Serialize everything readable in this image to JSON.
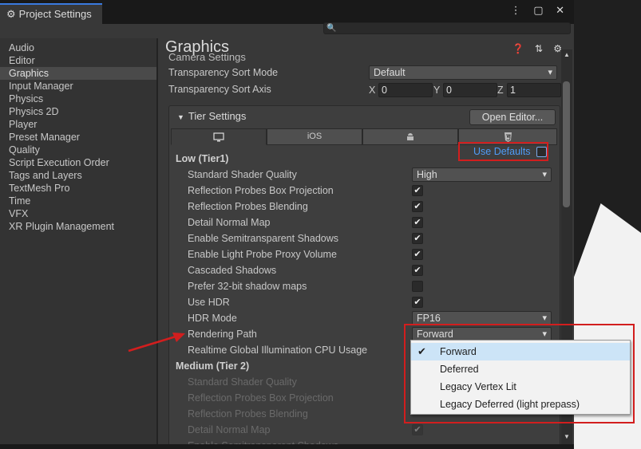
{
  "window": {
    "tab_title": "Project Settings",
    "titlebar_icons": "⋮ ▢ ✕"
  },
  "search": {
    "placeholder": "🔍"
  },
  "sidebar": {
    "items": [
      "Audio",
      "Editor",
      "Graphics",
      "Input Manager",
      "Physics",
      "Physics 2D",
      "Player",
      "Preset Manager",
      "Quality",
      "Script Execution Order",
      "Tags and Layers",
      "TextMesh Pro",
      "Time",
      "VFX",
      "XR Plugin Management"
    ],
    "active": "Graphics"
  },
  "header": {
    "title": "Graphics",
    "icons": "❓ ⇅ ⚙"
  },
  "camera": {
    "section": "Camera Settings",
    "sort_mode_label": "Transparency Sort Mode",
    "sort_mode_value": "Default",
    "sort_axis_label": "Transparency Sort Axis",
    "x_label": "X",
    "x_value": "0",
    "y_label": "Y",
    "y_value": "0",
    "z_label": "Z",
    "z_value": "1"
  },
  "tier": {
    "title": "Tier Settings",
    "open_editor": "Open Editor...",
    "platform_tabs": [
      "desktop-icon",
      "iOS",
      "android-icon",
      "html5-icon"
    ],
    "ios_label": "iOS",
    "low_header": "Low (Tier1)",
    "use_defaults": "Use Defaults",
    "shader_quality_label": "Standard Shader Quality",
    "shader_quality_value": "High",
    "box_projection": "Reflection Probes Box Projection",
    "blending": "Reflection Probes Blending",
    "detail_normal": "Detail Normal Map",
    "semi_shadows": "Enable Semitransparent Shadows",
    "lppv": "Enable Light Probe Proxy Volume",
    "cascaded": "Cascaded Shadows",
    "prefer32": "Prefer 32-bit shadow maps",
    "use_hdr": "Use HDR",
    "hdr_mode_label": "HDR Mode",
    "hdr_mode_value": "FP16",
    "rendering_path_label": "Rendering Path",
    "rendering_path_value": "Forward",
    "realtime_gi": "Realtime Global Illumination CPU Usage",
    "medium_header": "Medium (Tier 2)",
    "m_shader_quality": "Standard Shader Quality",
    "m_box_projection": "Reflection Probes Box Projection",
    "m_blending": "Reflection Probes Blending",
    "m_detail_normal": "Detail Normal Map",
    "m_semi_shadows": "Enable Semitransparent Shadows"
  },
  "popup": {
    "options": [
      "Forward",
      "Deferred",
      "Legacy Vertex Lit",
      "Legacy Deferred (light prepass)"
    ],
    "selected": "Forward",
    "tick": "✔"
  },
  "colors": {
    "highlight_red": "#d21e1e",
    "link_blue": "#4f9cf7",
    "selected_blue": "#cce4f7"
  }
}
